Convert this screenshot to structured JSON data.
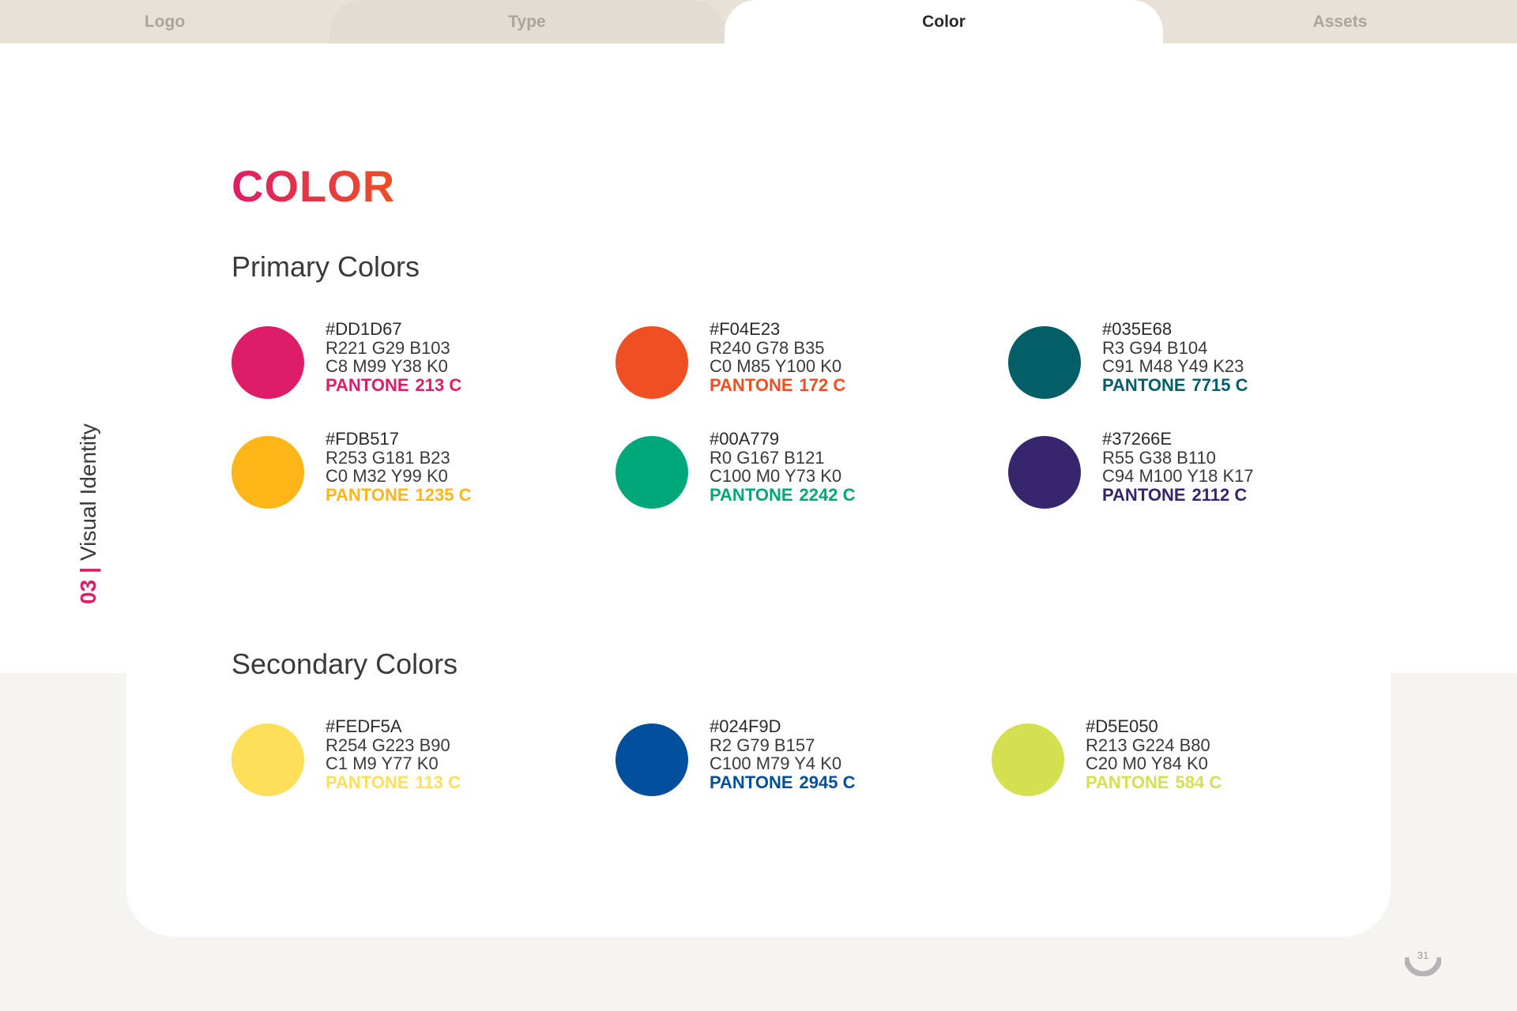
{
  "tabs": [
    {
      "label": "Logo"
    },
    {
      "label": "Type"
    },
    {
      "label": "Color"
    },
    {
      "label": "Assets"
    }
  ],
  "side": {
    "number": "03",
    "separator": "|",
    "label": "Visual Identity"
  },
  "title": "COLOR",
  "primary": {
    "heading": "Primary Colors",
    "swatches": [
      {
        "hex": "#DD1D67",
        "rgb": "R221 G29 B103",
        "cmyk": "C8 M99 Y38 K0",
        "pantone_label": "PANTONE",
        "pantone_code": "213 C",
        "color": "#DD1D67"
      },
      {
        "hex": "#F04E23",
        "rgb": "R240 G78 B35",
        "cmyk": "C0 M85 Y100 K0",
        "pantone_label": "PANTONE",
        "pantone_code": "172 C",
        "color": "#F04E23"
      },
      {
        "hex": "#035E68",
        "rgb": "R3 G94 B104",
        "cmyk": "C91 M48 Y49 K23",
        "pantone_label": "PANTONE",
        "pantone_code": "7715 C",
        "color": "#035E68"
      },
      {
        "hex": "#FDB517",
        "rgb": "R253 G181 B23",
        "cmyk": "C0 M32 Y99 K0",
        "pantone_label": "PANTONE",
        "pantone_code": "1235 C",
        "color": "#FDB517"
      },
      {
        "hex": "#00A779",
        "rgb": "R0 G167 B121",
        "cmyk": "C100 M0 Y73 K0",
        "pantone_label": "PANTONE",
        "pantone_code": "2242 C",
        "color": "#00A779"
      },
      {
        "hex": "#37266E",
        "rgb": "R55 G38 B110",
        "cmyk": "C94 M100 Y18 K17",
        "pantone_label": "PANTONE",
        "pantone_code": "2112 C",
        "color": "#37266E"
      }
    ]
  },
  "secondary": {
    "heading": "Secondary Colors",
    "swatches": [
      {
        "hex": "#FEDF5A",
        "rgb": "R254 G223 B90",
        "cmyk": "C1 M9 Y77 K0",
        "pantone_label": "PANTONE",
        "pantone_code": "113 C",
        "color": "#FEDF5A"
      },
      {
        "hex": "#024F9D",
        "rgb": "R2 G79 B157",
        "cmyk": "C100 M79 Y4 K0",
        "pantone_label": "PANTONE",
        "pantone_code": "2945 C",
        "color": "#024F9D"
      },
      {
        "hex": "#D5E050",
        "rgb": "R213 G224 B80",
        "cmyk": "C20 M0 Y84 K0",
        "pantone_label": "PANTONE",
        "pantone_code": "584 C",
        "color": "#D5E050"
      }
    ]
  },
  "page_number": "31",
  "accent": "#DD1D67"
}
